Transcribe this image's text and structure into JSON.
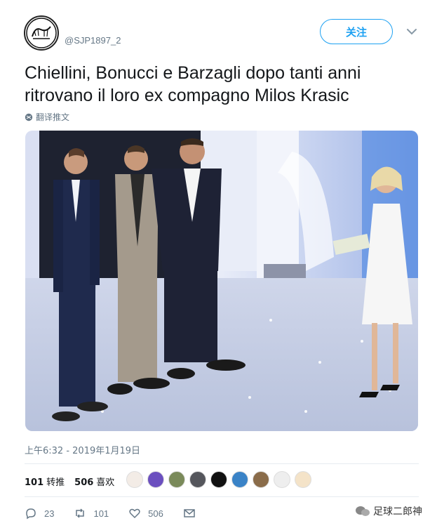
{
  "header": {
    "handle": "@SJP1897_2",
    "follow_label": "关注",
    "avatar_logo_text": "SF"
  },
  "tweet": {
    "line1": "Chiellini, Bonucci e Barzagli dopo tanti anni",
    "line2": "ritrovano il loro ex compagno Milos Krasic",
    "translate_label": "翻译推文",
    "photo_description_icon": "tv-studio-photo"
  },
  "meta": {
    "timestamp": "上午6:32 - 2019年1月19日"
  },
  "stats": {
    "retweets_count": "101",
    "retweets_label": "转推",
    "likes_count": "506",
    "likes_label": "喜欢"
  },
  "actions": {
    "reply_count": "23",
    "retweet_count": "101",
    "like_count": "506"
  },
  "watermark": {
    "text": "足球二郎神"
  },
  "colors": {
    "accent": "#1da1f2",
    "muted": "#657786"
  }
}
